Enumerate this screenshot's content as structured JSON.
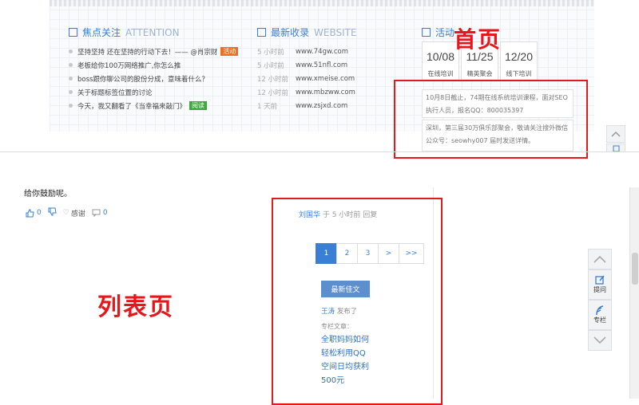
{
  "homepage": {
    "focus": {
      "title": "焦点关注",
      "title_en": "ATTENTION",
      "items": [
        {
          "text": "坚持坚持 还在坚持的行动下去！—— @肖宗财",
          "tag": "活动",
          "tag_color": "#f36c21"
        },
        {
          "text": "老板给你100万网络推广,你怎么推",
          "tag": ""
        },
        {
          "text": "boss跟你聊公司的股份分成，意味着什么？",
          "tag": ""
        },
        {
          "text": "关于标题标签位置的讨论",
          "tag": ""
        },
        {
          "text": "今天，我又翻看了《当幸福来敲门》",
          "tag": "阅读",
          "tag_color": "#3aa83a"
        }
      ]
    },
    "latest": {
      "title": "最新收录",
      "title_en": "WEBSITE",
      "items": [
        {
          "time": "5 小时前",
          "url": "www.74gw.com"
        },
        {
          "time": "5 小时前",
          "url": "www.51nfl.com"
        },
        {
          "time": "12 小时前",
          "url": "www.xmeise.com"
        },
        {
          "time": "12 小时前",
          "url": "www.mbzww.com"
        },
        {
          "time": "1 天前",
          "url": "www.zsjxd.com"
        }
      ]
    },
    "events": {
      "title": "活动",
      "dates": [
        {
          "date": "10/08",
          "label": "在线培训"
        },
        {
          "date": "11/25",
          "label": "精英聚会"
        },
        {
          "date": "12/20",
          "label": "线下培训"
        }
      ],
      "notices": [
        "10月8日截止，74期在线系统培训课程，面对SEO执行人员，报名QQ：800035397",
        "深圳，第三届30万俱乐部聚会，敬请关注搜外微信公众号：seowhy007 届时发送详情。"
      ]
    },
    "annotation_label": "首页"
  },
  "listpage": {
    "comment_text": "给你鼓励呢。",
    "actions": {
      "like_count": "0",
      "thanks_label": "感谢",
      "comment_count": "0"
    },
    "author_line": {
      "author": "刘国华",
      "meta": "于 5 小时前 回复"
    },
    "pagination": [
      "1",
      "2",
      "3",
      ">",
      ">>"
    ],
    "active_page": "1",
    "sidebar": {
      "title": "最新佳文",
      "author": "王涛",
      "author_suffix": "发布了",
      "column_label": "专栏文章：",
      "article_title": "全职妈妈如何轻松利用QQ空间日均获利500元"
    },
    "annotation_label": "列表页"
  },
  "side_tools": {
    "ask_label": "提问",
    "column_label": "专栏"
  },
  "colors": {
    "accent": "#3a7fd5",
    "annotation_red": "#e11b1b"
  }
}
